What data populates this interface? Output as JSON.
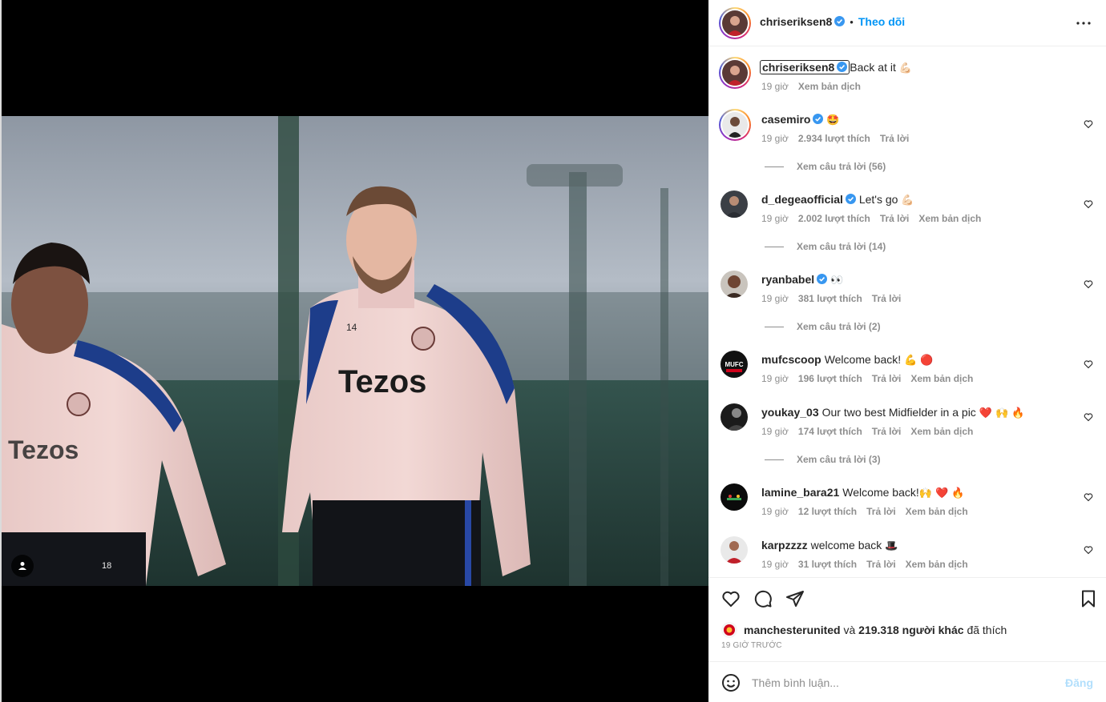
{
  "header": {
    "username": "chriseriksen8",
    "separator": "•",
    "follow_label": "Theo dõi",
    "more_icon": "more-horizontal-icon"
  },
  "caption": {
    "username": "chriseriksen8",
    "text": "Back at it",
    "emoji": "💪🏻",
    "time": "19 giờ",
    "translate": "Xem bản dịch"
  },
  "comments": [
    {
      "username": "casemiro",
      "verified": true,
      "text": "",
      "emoji": "🤩",
      "time": "19 giờ",
      "likes": "2.934 lượt thích",
      "reply": "Trả lời",
      "translate": "",
      "view_replies": "Xem câu trả lời (56)"
    },
    {
      "username": "d_degeaofficial",
      "verified": true,
      "text": "Let's go",
      "emoji": "💪🏻",
      "time": "19 giờ",
      "likes": "2.002 lượt thích",
      "reply": "Trả lời",
      "translate": "Xem bản dịch",
      "view_replies": "Xem câu trả lời (14)"
    },
    {
      "username": "ryanbabel",
      "verified": true,
      "text": "",
      "emoji": "👀",
      "time": "19 giờ",
      "likes": "381 lượt thích",
      "reply": "Trả lời",
      "translate": "",
      "view_replies": "Xem câu trả lời (2)"
    },
    {
      "username": "mufcscoop",
      "verified": false,
      "text": "Welcome back!",
      "emoji": "💪 🔴",
      "time": "19 giờ",
      "likes": "196 lượt thích",
      "reply": "Trả lời",
      "translate": "Xem bản dịch",
      "view_replies": ""
    },
    {
      "username": "youkay_03",
      "verified": false,
      "text": "Our two best Midfielder in a pic",
      "emoji": "❤️ 🙌 🔥",
      "time": "19 giờ",
      "likes": "174 lượt thích",
      "reply": "Trả lời",
      "translate": "Xem bản dịch",
      "view_replies": "Xem câu trả lời (3)"
    },
    {
      "username": "lamine_bara21",
      "verified": false,
      "text": "Welcome back!",
      "emoji": "🙌 ❤️ 🔥",
      "time": "19 giờ",
      "likes": "12 lượt thích",
      "reply": "Trả lời",
      "translate": "Xem bản dịch",
      "view_replies": ""
    },
    {
      "username": "karpzzzz",
      "verified": false,
      "text": "welcome back",
      "emoji": "🎩",
      "time": "19 giờ",
      "likes": "31 lượt thích",
      "reply": "Trả lời",
      "translate": "Xem bản dịch",
      "view_replies": ""
    }
  ],
  "photo": {
    "brand_text": "Tezos",
    "brand_text_partial": "Tezos",
    "shirt_number": "14",
    "shorts_number": "18",
    "tag_icon": "user-tag-icon"
  },
  "liked_by": {
    "username": "manchesterunited",
    "joiner": "và",
    "others": "219.318 người khác",
    "suffix": "đã thích"
  },
  "time_ago": "19 GIỜ TRƯỚC",
  "add_comment": {
    "placeholder": "Thêm bình luận...",
    "post_label": "Đăng"
  },
  "colors": {
    "accent": "#0095f6",
    "muted": "#8e8e8e",
    "post_disabled": "#b2dffc",
    "verified": "#3897f0"
  }
}
